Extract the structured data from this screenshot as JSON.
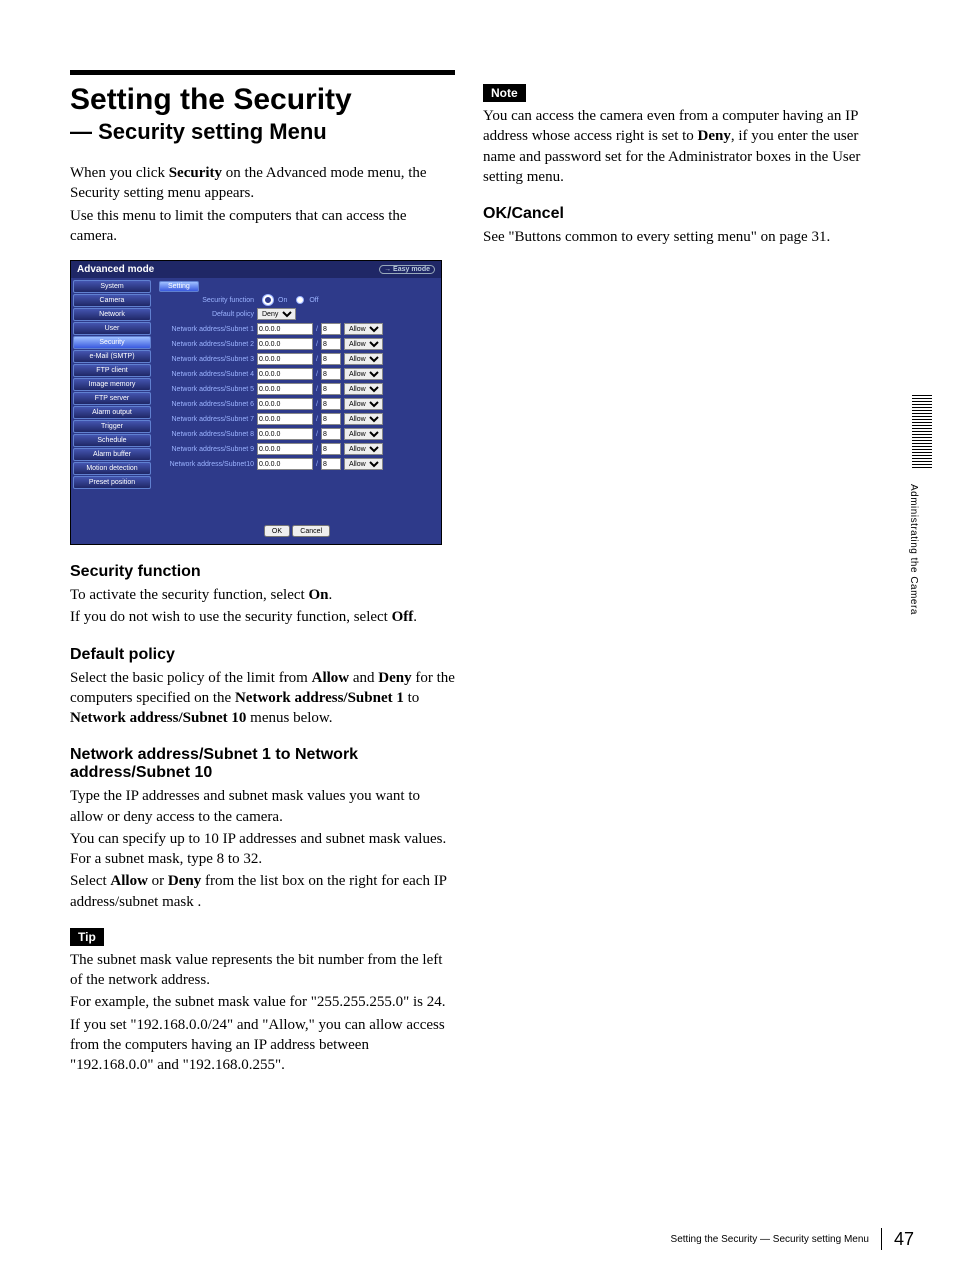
{
  "header": {
    "title": "Setting the Security",
    "subtitle": "— Security setting Menu"
  },
  "intro": {
    "l1a": "When you click ",
    "l1b": "Security",
    "l1c": " on the Advanced mode menu, the Security setting menu appears.",
    "l2": "Use this menu to limit the computers that can access the camera."
  },
  "screenshot": {
    "mode_title": "Advanced mode",
    "easy_mode": "→ Easy mode",
    "sidebar": [
      "System",
      "Camera",
      "Network",
      "User",
      "Security",
      "e-Mail (SMTP)",
      "FTP client",
      "Image memory",
      "FTP server",
      "Alarm output",
      "Trigger",
      "Schedule",
      "Alarm buffer",
      "Motion detection",
      "Preset position"
    ],
    "active_index": 4,
    "tab": "Setting",
    "secfunc_label": "Security function",
    "on": "On",
    "off": "Off",
    "default_policy_label": "Default policy",
    "deny": "Deny",
    "rows": [
      "Network address/Subnet 1",
      "Network address/Subnet 2",
      "Network address/Subnet 3",
      "Network address/Subnet 4",
      "Network address/Subnet 5",
      "Network address/Subnet 6",
      "Network address/Subnet 7",
      "Network address/Subnet 8",
      "Network address/Subnet 9",
      "Network address/Subnet10"
    ],
    "ip": "0.0.0.0",
    "mask": "8",
    "allow": "Allow",
    "slash": "/",
    "ok": "OK",
    "cancel": "Cancel"
  },
  "sections": {
    "sf_h": "Security function",
    "sf1a": "To activate the security function, select ",
    "sf1b": "On",
    "sf1c": ".",
    "sf2a": "If you do not wish to use the security function, select ",
    "sf2b": "Off",
    "sf2c": ".",
    "dp_h": "Default policy",
    "dp1a": "Select the basic policy of the limit from ",
    "dp1b": "Allow",
    "dp1c": " and ",
    "dp1d": "Deny",
    "dp1e": " for the computers specified on the ",
    "dp1f": "Network address/Subnet 1",
    "dp1g": " to ",
    "dp1h": "Network address/Subnet 10",
    "dp1i": " menus below.",
    "na_h": "Network address/Subnet 1 to Network address/Subnet 10",
    "na1": "Type the IP addresses and subnet mask values you want to allow or deny access to the camera.",
    "na2": "You can specify up to 10 IP addresses and subnet mask values.  For a subnet mask, type 8 to 32.",
    "na3a": "Select ",
    "na3b": "Allow",
    "na3c": " or ",
    "na3d": "Deny",
    "na3e": " from the list box on the right for each IP address/subnet mask .",
    "tip_label": "Tip",
    "tip1": "The subnet mask value represents the bit number from the left of the network address.",
    "tip2": "For example, the subnet mask value for \"255.255.255.0\" is 24.",
    "tip3": "If you set \"192.168.0.0/24\" and \"Allow,\" you can allow access from the computers having an IP address between \"192.168.0.0\" and \"192.168.0.255\".",
    "note_label": "Note",
    "note1a": "You can access the camera even from a computer having an IP address whose access right is set to ",
    "note1b": "Deny",
    "note1c": ", if you enter the user name and password set for the Administrator boxes in the User setting menu.",
    "okc_h": "OK/Cancel",
    "okc1": "See \"Buttons common to every setting menu\" on page 31."
  },
  "side_text": "Administrating the Camera",
  "footer": {
    "title": "Setting the Security — Security setting Menu",
    "page": "47"
  }
}
